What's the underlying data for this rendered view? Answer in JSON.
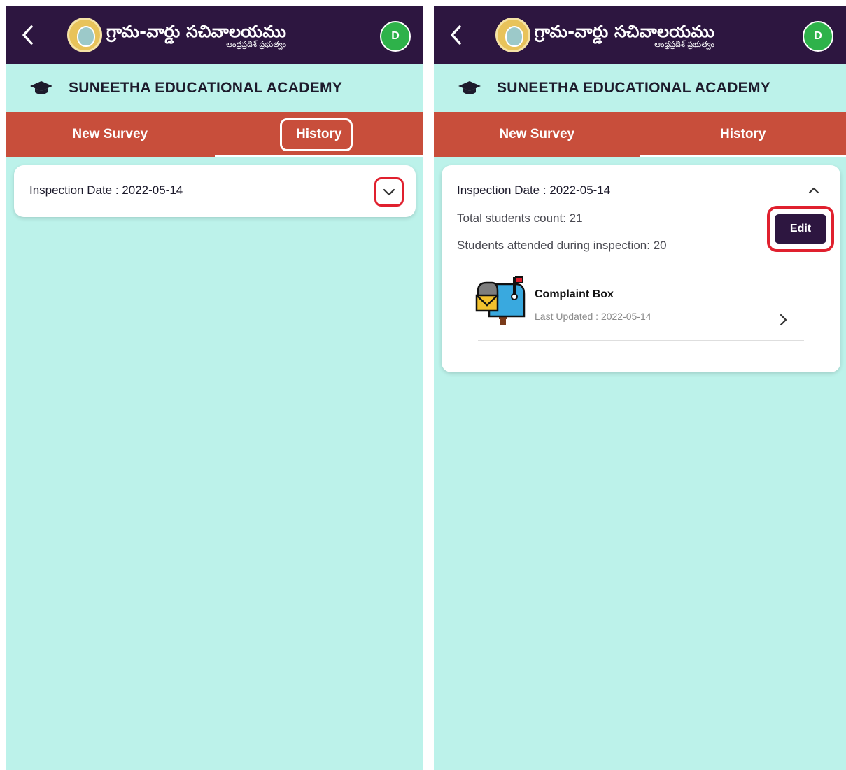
{
  "app": {
    "brand_title": "గ్రామ-వార్డు సచివాలయము",
    "brand_subtitle": "ఆంధ్రప్రదేశ్ ప్రభుత్వం",
    "avatar_initial": "D",
    "school_name": "SUNEETHA EDUCATIONAL ACADEMY"
  },
  "tabs": {
    "new_survey": "New Survey",
    "history": "History"
  },
  "left_panel": {
    "inspection_date": "Inspection Date : 2022-05-14"
  },
  "right_panel": {
    "inspection_date": "Inspection Date : 2022-05-14",
    "total_students": "Total students count: 21",
    "students_attended": "Students attended during inspection: 20",
    "edit_label": "Edit",
    "item": {
      "title": "Complaint Box",
      "last_updated": "Last Updated :  2022-05-14"
    }
  },
  "colors": {
    "header": "#2d1640",
    "tabs": "#c84e3b",
    "background": "#bcf2ea",
    "highlight": "#e0202e",
    "avatar": "#2eb24a"
  },
  "icons": [
    "back-icon",
    "graduation-cap-icon",
    "chevron-down-icon",
    "chevron-up-icon",
    "mailbox-icon",
    "chevron-right-icon"
  ]
}
